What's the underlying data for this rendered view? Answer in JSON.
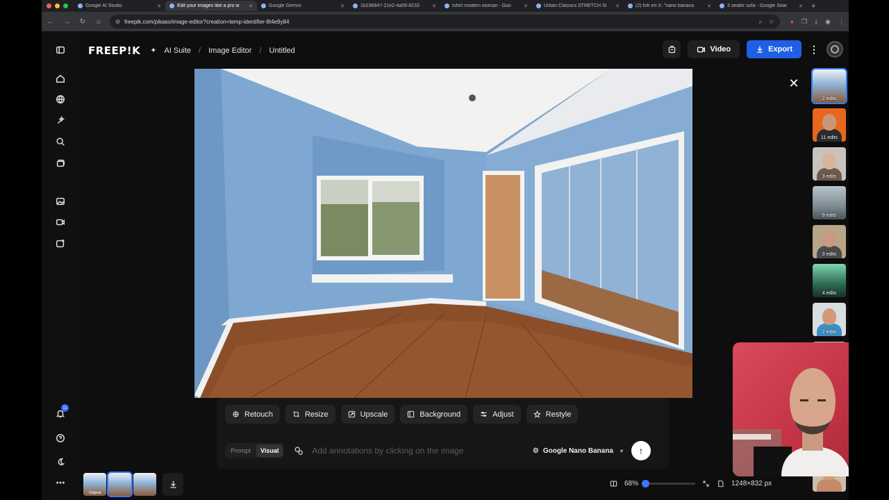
{
  "browser": {
    "tabs": [
      {
        "label": "Google AI Studio",
        "active": false
      },
      {
        "label": "Edit your images like a pro w",
        "active": true
      },
      {
        "label": "Google Gemini",
        "active": false
      },
      {
        "label": "1b236847-21e2-4a59-8233",
        "active": false
      },
      {
        "label": "tshirt modern woman - Goo",
        "active": false
      },
      {
        "label": "Urban Classics STRETCH SI",
        "active": false
      },
      {
        "label": "(2) fofr en X: \"nano banana",
        "active": false
      },
      {
        "label": "3 seater sofa - Google Sear",
        "active": false
      }
    ],
    "url": "freepik.com/pikaso/image-editor?creation=temp-identifier-8t4e9y84"
  },
  "header": {
    "logo": "FREEP!K",
    "breadcrumb": [
      "AI Suite",
      "Image Editor",
      "Untitled"
    ],
    "video_label": "Video",
    "export_label": "Export"
  },
  "sidebar": {
    "notification_count": "11"
  },
  "toolbar": {
    "tools": [
      {
        "label": "Retouch",
        "icon": "retouch-icon"
      },
      {
        "label": "Resize",
        "icon": "resize-icon"
      },
      {
        "label": "Upscale",
        "icon": "upscale-icon"
      },
      {
        "label": "Background",
        "icon": "background-icon"
      },
      {
        "label": "Adjust",
        "icon": "adjust-icon"
      },
      {
        "label": "Restyle",
        "icon": "restyle-icon"
      }
    ],
    "mode_prompt": "Prompt",
    "mode_visual": "Visual",
    "annotation_placeholder": "Add annotations by clicking on the image",
    "model": "Google Nano Banana"
  },
  "bottom": {
    "original_label": "Original",
    "zoom": "68%",
    "zoom_fraction": 0.68,
    "dimensions": "1248×832 px"
  },
  "history": [
    {
      "edits": "2 edits",
      "selected": true,
      "kind": "room"
    },
    {
      "edits": "11 edits",
      "selected": false,
      "kind": "orange"
    },
    {
      "edits": "3 edits",
      "selected": false,
      "kind": "woman"
    },
    {
      "edits": "9 edits",
      "selected": false,
      "kind": "city"
    },
    {
      "edits": "3 edits",
      "selected": false,
      "kind": "man"
    },
    {
      "edits": "4 edits",
      "selected": false,
      "kind": "green"
    },
    {
      "edits": "2 edits",
      "selected": false,
      "kind": "man2"
    },
    {
      "edits": "",
      "selected": false,
      "kind": "body"
    },
    {
      "edits": "",
      "selected": false,
      "kind": "body"
    },
    {
      "edits": "",
      "selected": false,
      "kind": "body"
    },
    {
      "edits": "",
      "selected": false,
      "kind": "body"
    }
  ],
  "colors": {
    "accent": "#1f5fe6",
    "selection": "#3b78ff",
    "wall": "#7fa6cf",
    "floor": "#8a4f2a"
  }
}
